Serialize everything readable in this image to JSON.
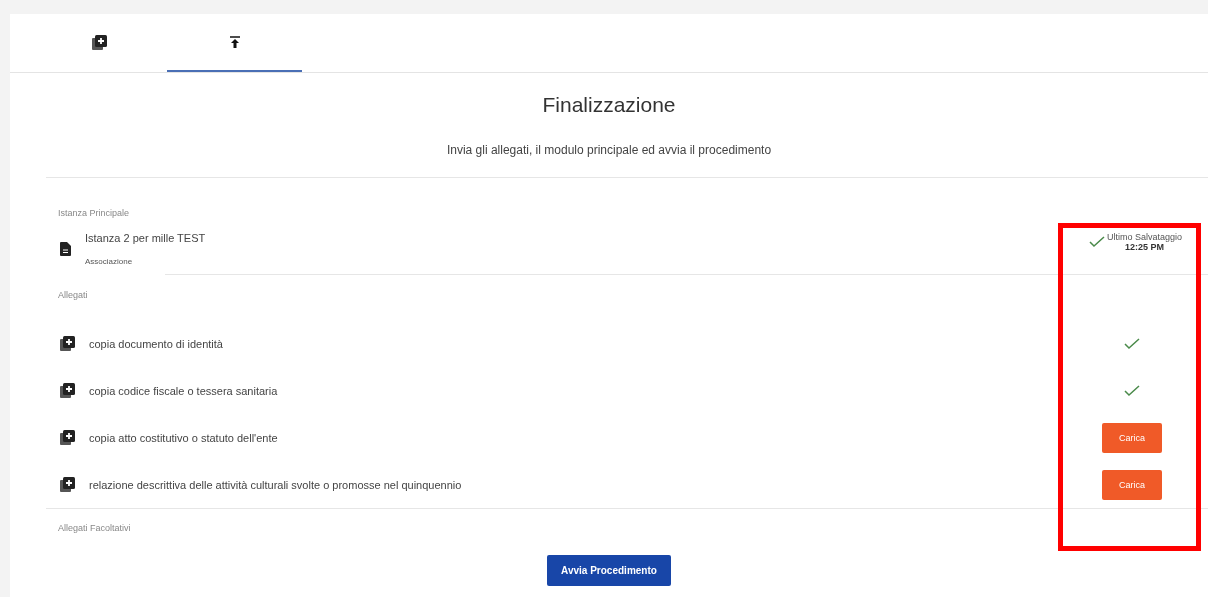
{
  "tabs": [
    {
      "kind": "add",
      "selected": false
    },
    {
      "kind": "upload",
      "selected": true
    }
  ],
  "title": "Finalizzazione",
  "subtitle": "Invia gli allegati, il modulo principale ed avvia il procedimento",
  "main_section": {
    "label": "Istanza Principale",
    "name": "Istanza 2 per mille TEST",
    "type": "Associazione",
    "save_label": "Ultimo Salvataggio",
    "save_time": "12:25 PM"
  },
  "attachments_section": {
    "label": "Allegati",
    "items": [
      {
        "name": "copia documento di identità",
        "uploaded": true
      },
      {
        "name": "copia codice fiscale o tessera sanitaria",
        "uploaded": true
      },
      {
        "name": "copia atto costitutivo o statuto dell'ente",
        "uploaded": false,
        "button": "Carica"
      },
      {
        "name": "relazione descrittiva delle attività culturali svolte o promosse nel quinquennio",
        "uploaded": false,
        "button": "Carica"
      }
    ]
  },
  "optional_section": {
    "label": "Allegati Facoltativi"
  },
  "submit_button": "Avvia Procedimento",
  "highlight": true
}
